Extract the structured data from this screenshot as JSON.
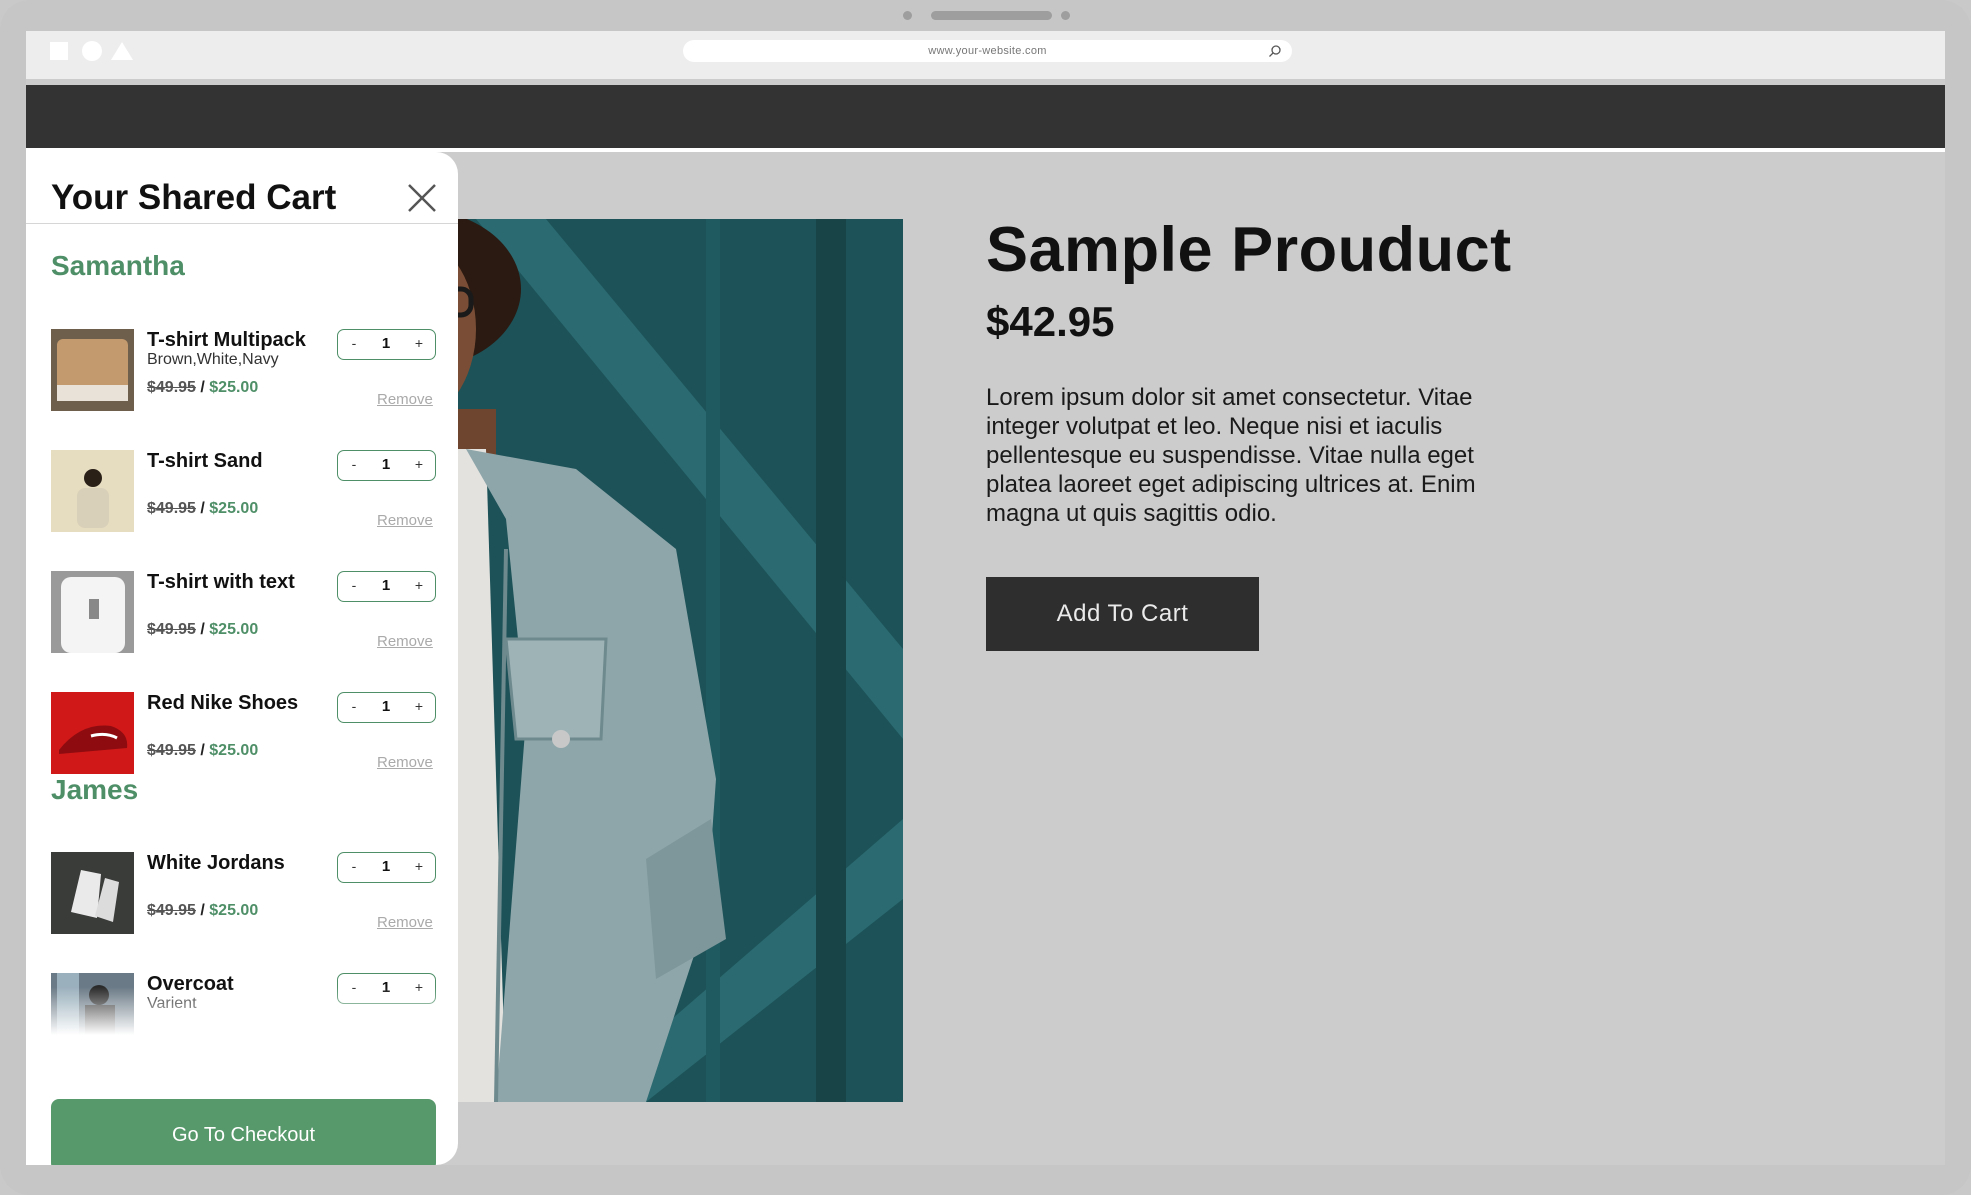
{
  "browser": {
    "url": "www.your-website.com",
    "icons": [
      "square-icon",
      "circle-icon",
      "triangle-icon",
      "search-icon"
    ]
  },
  "product": {
    "title": "Sample Prouduct",
    "price": "$42.95",
    "description": "Lorem ipsum dolor sit amet consectetur. Vitae integer volutpat et leo. Neque nisi et iaculis pellentesque eu suspendisse. Vitae nulla eget platea laoreet eget adipiscing ultrices at. Enim magna ut quis sagittis odio.",
    "add_to_cart_label": "Add To Cart"
  },
  "cart": {
    "title": "Your Shared Cart",
    "close_icon": "close-icon",
    "checkout_label": "Go To Checkout",
    "remove_label": "Remove",
    "people": [
      {
        "name": "Samantha",
        "items": [
          {
            "name": "T-shirt Multipack",
            "variant": "Brown,White,Navy",
            "old_price": "$49.95",
            "separator": " / ",
            "new_price": "$25.00",
            "qty": "1"
          },
          {
            "name": "T-shirt Sand",
            "variant": "",
            "old_price": "$49.95",
            "separator": " / ",
            "new_price": "$25.00",
            "qty": "1"
          },
          {
            "name": "T-shirt with text",
            "variant": "",
            "old_price": "$49.95",
            "separator": " / ",
            "new_price": "$25.00",
            "qty": "1"
          },
          {
            "name": "Red Nike Shoes",
            "variant": "",
            "old_price": "$49.95",
            "separator": " / ",
            "new_price": "$25.00",
            "qty": "1"
          }
        ]
      },
      {
        "name": "James",
        "items": [
          {
            "name": "White Jordans",
            "variant": "",
            "old_price": "$49.95",
            "separator": " / ",
            "new_price": "$25.00",
            "qty": "1"
          },
          {
            "name": "Overcoat",
            "variant": "Varient",
            "qty": "1"
          }
        ]
      }
    ],
    "stepper": {
      "minus": "-",
      "plus": "+"
    }
  },
  "colors": {
    "accent_green": "#4f8f68",
    "checkout_green": "#58996c",
    "dark_button": "#2e2e2e",
    "navbar": "#333333",
    "page_bg": "#cccccc"
  }
}
